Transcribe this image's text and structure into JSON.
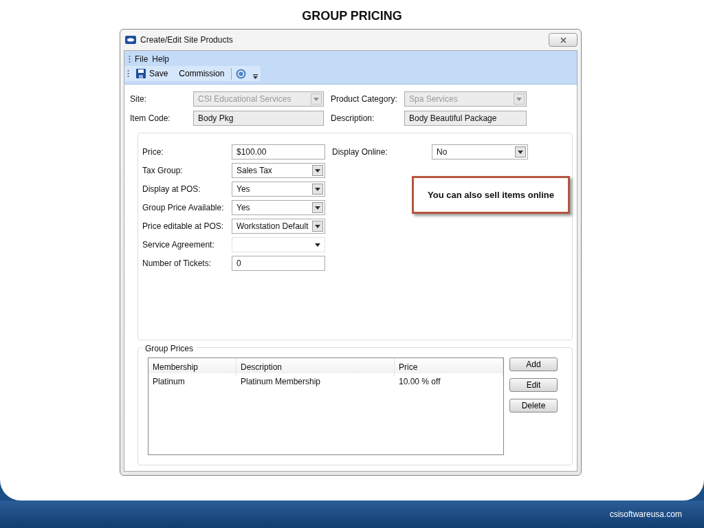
{
  "slide_title": "GROUP PRICING",
  "window": {
    "title": "Create/Edit Site Products"
  },
  "menu": [
    "File",
    "Help"
  ],
  "toolbar": [
    {
      "kind": "save",
      "label": "Save"
    },
    {
      "kind": "text",
      "label": "Commission"
    },
    {
      "kind": "help"
    }
  ],
  "header_fields": [
    {
      "label": "Site:",
      "value": "CSI Educational Services",
      "kind": "combo",
      "disabled": true
    },
    {
      "label": "Product Category:",
      "value": "Spa Services",
      "kind": "combo",
      "disabled": true
    },
    {
      "label": "Item Code:",
      "value": "Body Pkg",
      "kind": "text",
      "disabled": true
    },
    {
      "label": "Description:",
      "value": "Body Beautiful Package",
      "kind": "text",
      "disabled": true
    }
  ],
  "fields": [
    {
      "label": "Price:",
      "value": "$100.00",
      "kind": "text"
    },
    {
      "label": "Tax Group:",
      "value": "Sales Tax",
      "kind": "combo"
    },
    {
      "label": "Display at POS:",
      "value": "Yes",
      "kind": "combo"
    },
    {
      "label": "Group Price Available:",
      "value": "Yes",
      "kind": "combo"
    },
    {
      "label": "Price editable at POS:",
      "value": "Workstation Default",
      "kind": "combo"
    },
    {
      "label": "Service Agreement:",
      "kind": "flat"
    },
    {
      "label": "Number of Tickets:",
      "value": "0",
      "kind": "text"
    }
  ],
  "online_field": {
    "label": "Display Online:",
    "value": "No",
    "kind": "combo"
  },
  "callout": "You can also sell items online",
  "group_prices": {
    "title": "Group Prices",
    "columns": [
      "Membership",
      "Description",
      "Price"
    ],
    "rows": [
      [
        "Platinum",
        "Platinum Membership",
        "10.00 % off"
      ]
    ],
    "buttons": [
      "Add",
      "Edit",
      "Delete"
    ]
  },
  "footer": "csisoftwareusa.com"
}
